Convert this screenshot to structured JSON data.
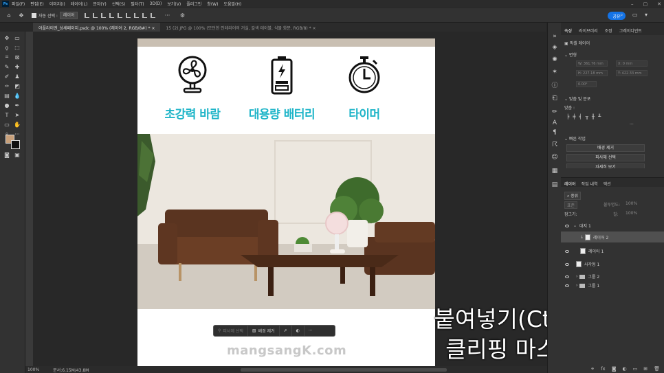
{
  "app": {
    "logo": "Ps",
    "menu": [
      "파일(F)",
      "편집(E)",
      "이미지(I)",
      "레이어(L)",
      "문자(Y)",
      "선택(S)",
      "필터(T)",
      "3D(D)",
      "보기(V)",
      "플러그인",
      "창(W)",
      "도움말(H)"
    ],
    "window_controls": [
      "–",
      "▢",
      "✕"
    ]
  },
  "options_bar": {
    "auto_select_label": "자동 선택 :",
    "auto_select_value": "레이어",
    "share_label": "공유"
  },
  "tabs": [
    {
      "label": "어플라이엔_상세페이지.psdc @ 100% (레이어 2, RGB/8#) *",
      "active": true
    },
    {
      "label": "15 (2).JPG @ 100% (모던한 인테리어의 거실, 갈색 테이블, 식물 화분, RGB/8) *",
      "active": false
    }
  ],
  "canvas": {
    "features": [
      {
        "icon": "fan-icon",
        "label": "초강력 바람"
      },
      {
        "icon": "battery-icon",
        "label": "대용량 배터리"
      },
      {
        "icon": "stopwatch-icon",
        "label": "타이머"
      }
    ],
    "watermark": "mangsangK.com"
  },
  "task_bar": {
    "select_subject": "피사체 선택",
    "remove_bg": "배경 제거"
  },
  "caption": {
    "line1": "붙여넣기(Ctrl+V) 후",
    "line2": "클리핑 마스크 실행"
  },
  "status_bar": {
    "zoom": "100%",
    "doc_info": "문서:6.15M/43.8M"
  },
  "properties": {
    "tabs": [
      "속성",
      "라이브러리",
      "조정",
      "그레이디언트"
    ],
    "layer_type": "픽셀 레이어",
    "transform_heading": "변형",
    "w": "W: 361.76 mm",
    "h": "H: 227.18 mm",
    "x": "X: 0 mm",
    "y": "Y: 422.33 mm",
    "angle": "0.00°",
    "align_heading": "맞춤 및 분포",
    "align_label": "맞춤 :",
    "quick_heading": "빠른 작업",
    "quick_buttons": [
      "배경 제거",
      "피사체 선택",
      "자세히 보기"
    ]
  },
  "layers_panel": {
    "tabs": [
      "레이어",
      "작업 내역",
      "액션"
    ],
    "filter_kind": "종류",
    "blend_mode": "표준",
    "opacity_label": "불투명도:",
    "opacity": "100%",
    "lock_label": "잠그기:",
    "fill_label": "칠:",
    "fill": "100%",
    "rows": [
      {
        "name": "대지 1",
        "type": "artboard",
        "selected": false
      },
      {
        "name": "레이어 2",
        "type": "layer",
        "selected": true
      },
      {
        "name": "레이어 1",
        "type": "layer",
        "selected": false
      },
      {
        "name": "사각형 1",
        "type": "shape",
        "selected": false
      },
      {
        "name": "그룹 2",
        "type": "group",
        "selected": false
      },
      {
        "name": "그룹 1",
        "type": "group",
        "selected": false
      }
    ]
  },
  "colors": {
    "accent": "#1fb5c8",
    "share": "#1473e6",
    "foreground_swatch": "#c8a07a",
    "background_swatch": "#111111"
  }
}
